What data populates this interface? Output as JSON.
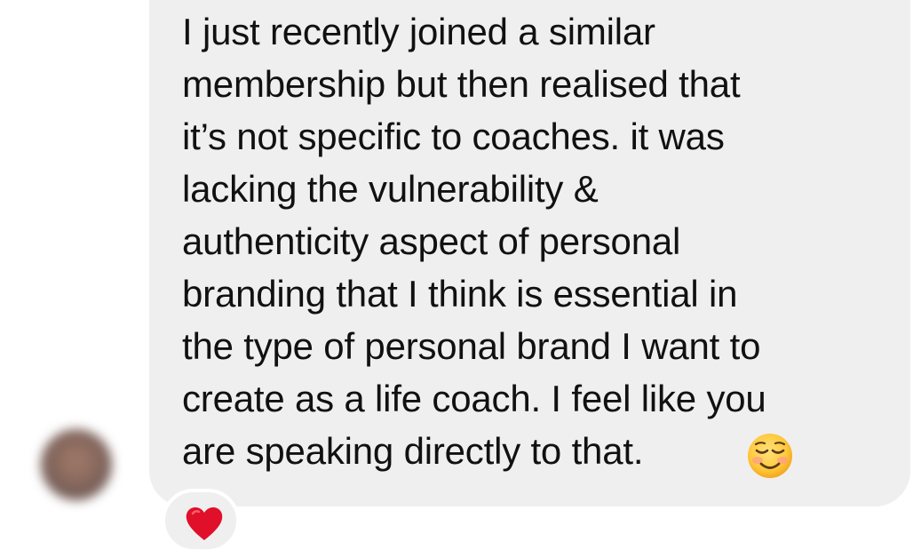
{
  "message": {
    "lines": [
      "I just recently joined a similar",
      "membership but then realised that",
      "it’s not specific to coaches. it was",
      "lacking the vulnerability &",
      "authenticity aspect of personal",
      "branding that I think is essential in",
      "the type of personal brand I want to",
      "create as a life coach. I feel like you",
      "are speaking directly to that."
    ],
    "emoji": "smiling-face-icon",
    "bubble_color": "#efeff0",
    "text_color": "#111111"
  },
  "reaction": {
    "icon": "heart-icon",
    "color": "#e0102a"
  },
  "avatar": {
    "icon": "avatar"
  }
}
